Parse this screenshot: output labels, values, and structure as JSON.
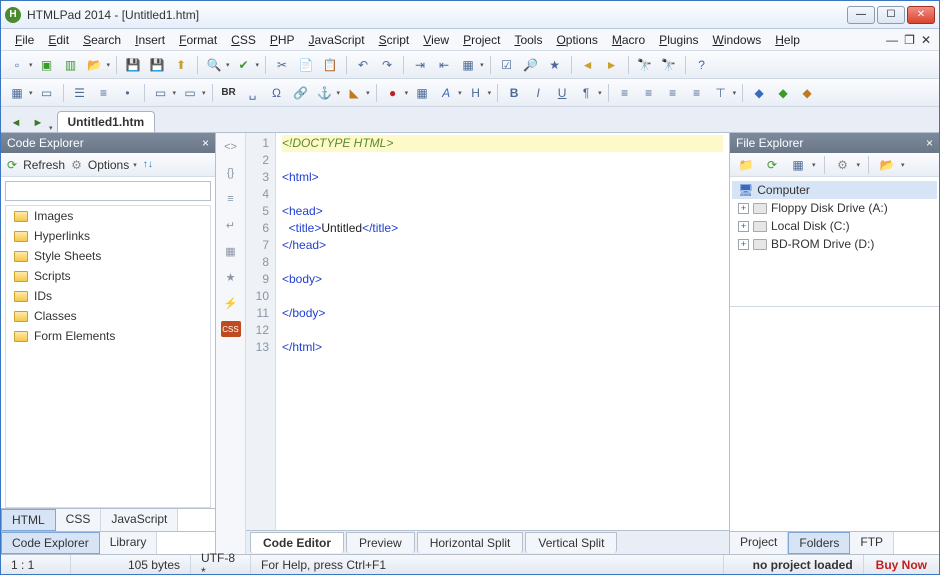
{
  "titlebar": {
    "app": "HTMLPad 2014",
    "doc": "[Untitled1.htm]"
  },
  "menu": [
    "File",
    "Edit",
    "Search",
    "Insert",
    "Format",
    "CSS",
    "PHP",
    "JavaScript",
    "Script",
    "View",
    "Project",
    "Tools",
    "Options",
    "Macro",
    "Plugins",
    "Windows",
    "Help"
  ],
  "file_tab": "Untitled1.htm",
  "code_explorer": {
    "title": "Code Explorer",
    "refresh": "Refresh",
    "options": "Options",
    "items": [
      "Images",
      "Hyperlinks",
      "Style Sheets",
      "Scripts",
      "IDs",
      "Classes",
      "Form Elements"
    ],
    "lang_tabs": [
      "HTML",
      "CSS",
      "JavaScript"
    ],
    "bottom_tabs": [
      "Code Explorer",
      "Library"
    ]
  },
  "editor": {
    "lines": [
      {
        "n": "1",
        "cls": "hl",
        "html": "<span class='doctype'>&lt;!DOCTYPE HTML&gt;</span>"
      },
      {
        "n": "2",
        "html": ""
      },
      {
        "n": "3",
        "html": "<span class='tag'>&lt;html&gt;</span>"
      },
      {
        "n": "4",
        "html": ""
      },
      {
        "n": "5",
        "html": "<span class='tag'>&lt;head&gt;</span>"
      },
      {
        "n": "6",
        "html": "  <span class='tag'>&lt;title&gt;</span><span class='txt'>Untitled</span><span class='tag'>&lt;/title&gt;</span>"
      },
      {
        "n": "7",
        "html": "<span class='tag'>&lt;/head&gt;</span>"
      },
      {
        "n": "8",
        "html": ""
      },
      {
        "n": "9",
        "html": "<span class='tag'>&lt;body&gt;</span>"
      },
      {
        "n": "10",
        "html": ""
      },
      {
        "n": "11",
        "html": "<span class='tag'>&lt;/body&gt;</span>"
      },
      {
        "n": "12",
        "html": ""
      },
      {
        "n": "13",
        "html": "<span class='tag'>&lt;/html&gt;</span>"
      }
    ],
    "bottom_tabs": [
      "Code Editor",
      "Preview",
      "Horizontal Split",
      "Vertical Split"
    ]
  },
  "file_explorer": {
    "title": "File Explorer",
    "root": "Computer",
    "drives": [
      "Floppy Disk Drive (A:)",
      "Local Disk (C:)",
      "BD-ROM Drive (D:)"
    ],
    "bottom_tabs": [
      "Project",
      "Folders",
      "FTP"
    ]
  },
  "status": {
    "pos": "1 : 1",
    "size": "105 bytes",
    "enc": "UTF-8 *",
    "help": "For Help, press Ctrl+F1",
    "project": "no project loaded",
    "buy": "Buy Now"
  }
}
